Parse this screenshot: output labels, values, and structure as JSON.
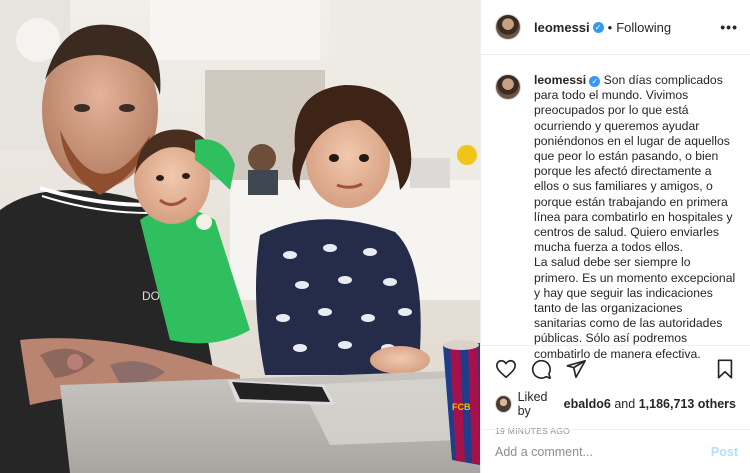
{
  "post": {
    "username": "leomessi",
    "verified": true,
    "separator": "•",
    "follow_status": "Following",
    "more_icon": "more-horizontal-icon",
    "caption": "Son días complicados para todo el mundo. Vivimos preocupados por lo que está ocurriendo y queremos ayudar poniéndonos en el lugar de aquellos que peor lo están pasando, o bien porque les afectó directamente a ellos o sus familiares y amigos, o porque están trabajando en primera línea para combatirlo en hospitales y centros de salud. Quiero enviarles mucha fuerza a todos ellos.\nLa salud debe ser siempre lo primero. Es un momento excepcional y hay que seguir las indicaciones tanto de las organizaciones sanitarias como de las autoridades públicas. Sólo así podremos combatirlo de manera efectiva."
  },
  "photo": {
    "shirt_text": "DOCE B",
    "cup_text": "FCB"
  },
  "actions": {
    "like_icon": "heart-icon",
    "comment_icon": "comment-icon",
    "share_icon": "share-icon",
    "save_icon": "bookmark-icon"
  },
  "likes": {
    "prefix": "Liked by",
    "user": "ebaldo6",
    "joiner": "and",
    "count": "1,186,713",
    "suffix": "others"
  },
  "timestamp": "19 MINUTES AGO",
  "comment": {
    "placeholder": "Add a comment...",
    "post_label": "Post"
  },
  "colors": {
    "accent_blue": "#3897f0",
    "post_disabled": "#b2dffc",
    "muted": "#8e8e8e",
    "text": "#262626"
  }
}
